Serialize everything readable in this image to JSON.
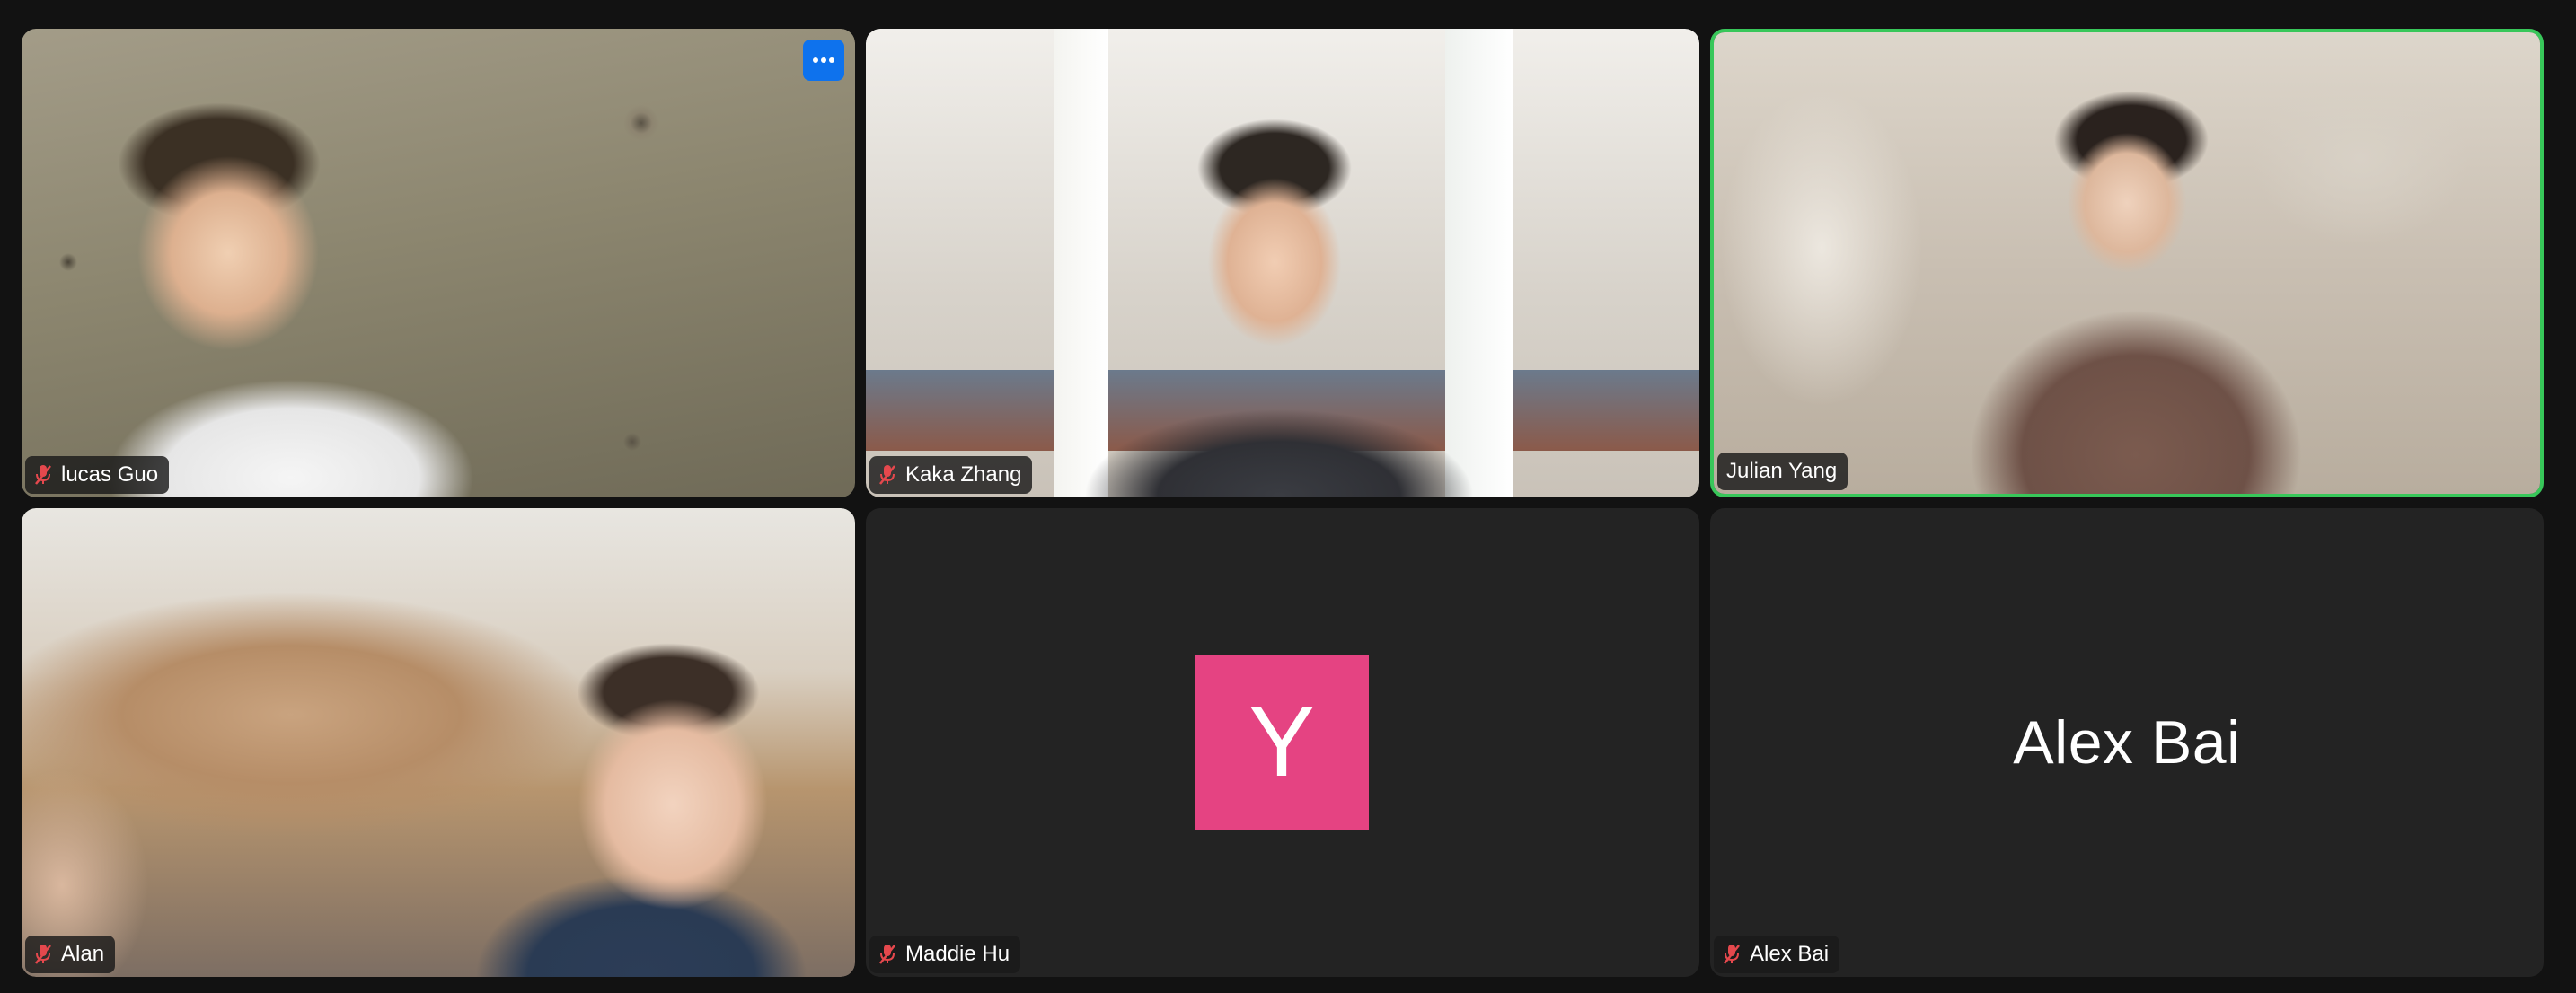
{
  "participants": [
    {
      "name": "lucas Guo",
      "muted": true,
      "video": true
    },
    {
      "name": "Kaka Zhang",
      "muted": true,
      "video": true
    },
    {
      "name": "Julian Yang",
      "muted": false,
      "video": true,
      "active_speaker": true
    },
    {
      "name": "Alan",
      "muted": true,
      "video": true
    },
    {
      "name": "Maddie Hu",
      "muted": true,
      "video": false,
      "avatar_letter": "Y",
      "avatar_color": "#e54382"
    },
    {
      "name": "Alex Bai",
      "muted": true,
      "video": false,
      "display_name": "Alex Bai"
    }
  ],
  "icons": {
    "mic": "mic-muted-icon",
    "more": "more-options-icon"
  },
  "colors": {
    "background": "#121212",
    "tile": "#232323",
    "active_speaker_border": "#38c75a",
    "more_button": "#0e72ed",
    "muted_icon": "#e5484d"
  }
}
